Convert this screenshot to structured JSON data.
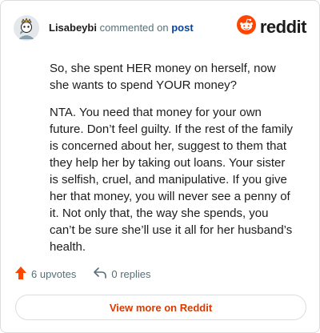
{
  "header": {
    "username": "Lisabeybi",
    "action_text": "commented on",
    "post_link": "post",
    "logo_text": "reddit"
  },
  "comment": {
    "paragraphs": [
      "So, she spent HER money on herself, now she wants to spend YOUR money?",
      "NTA. You need that money for your own future. Don’t feel guilty. If the rest of the family is concerned about her, suggest to them that they help her by taking out loans. Your sister is selfish, cruel, and manipulative. If you give her that money, you will never see a penny of it. Not only that, the way she spends, you can’t be sure she’ll use it all for her husband’s health."
    ]
  },
  "footer": {
    "upvotes": "6 upvotes",
    "replies": "0 replies",
    "view_more": "View more on Reddit"
  },
  "colors": {
    "brand_orange": "#ff4500",
    "link_blue": "#0a449b",
    "button_text": "#d93a00",
    "muted": "#576f76"
  },
  "icons": {
    "avatar": "user-avatar-icon",
    "logo": "reddit-snoo-icon",
    "upvote": "upvote-arrow-icon",
    "reply": "reply-arrow-icon"
  }
}
